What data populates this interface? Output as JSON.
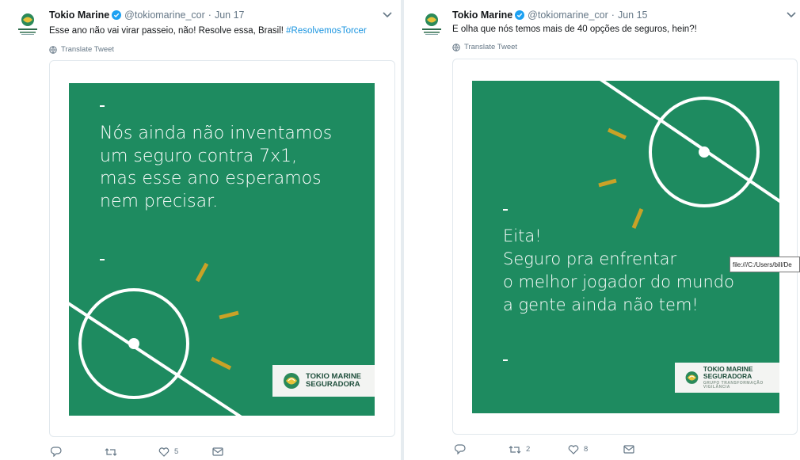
{
  "tweets": [
    {
      "name": "Tokio Marine",
      "handle": "@tokiomarine_cor",
      "separator": "·",
      "date": "Jun 17",
      "text": "Esse ano não vai virar passeio, não! Resolve essa, Brasil! ",
      "hashtag": "#ResolvemosTorcer",
      "translate": "Translate Tweet",
      "image_text": [
        "Nós ainda não inventamos",
        "um seguro contra 7x1,",
        "mas esse ano esperamos",
        "nem precisar."
      ],
      "logo": [
        "TOKIO MARINE",
        "SEGURADORA"
      ],
      "actions": {
        "reply": "",
        "retweet": "",
        "like": "5",
        "dm": ""
      }
    },
    {
      "name": "Tokio Marine",
      "handle": "@tokiomarine_cor",
      "separator": "·",
      "date": "Jun 15",
      "text": "E olha que nós temos mais de 40 opções de seguros, hein?!",
      "translate": "Translate Tweet",
      "image_text": [
        "Eita!",
        "Seguro pra enfrentar",
        "o melhor jogador do mundo",
        "a gente ainda não tem!"
      ],
      "logo": [
        "TOKIO MARINE",
        "SEGURADORA"
      ],
      "logo_sub": "GRUPO TRANSFORMAÇÃO  VIGILÂNCIA",
      "actions": {
        "reply": "",
        "retweet": "2",
        "like": "8",
        "dm": ""
      }
    }
  ],
  "tooltip": "file:///C:/Users/bill/De",
  "colors": {
    "field_green": "#1e8b60",
    "gold": "#c9a227",
    "link_blue": "#1b95e0"
  }
}
